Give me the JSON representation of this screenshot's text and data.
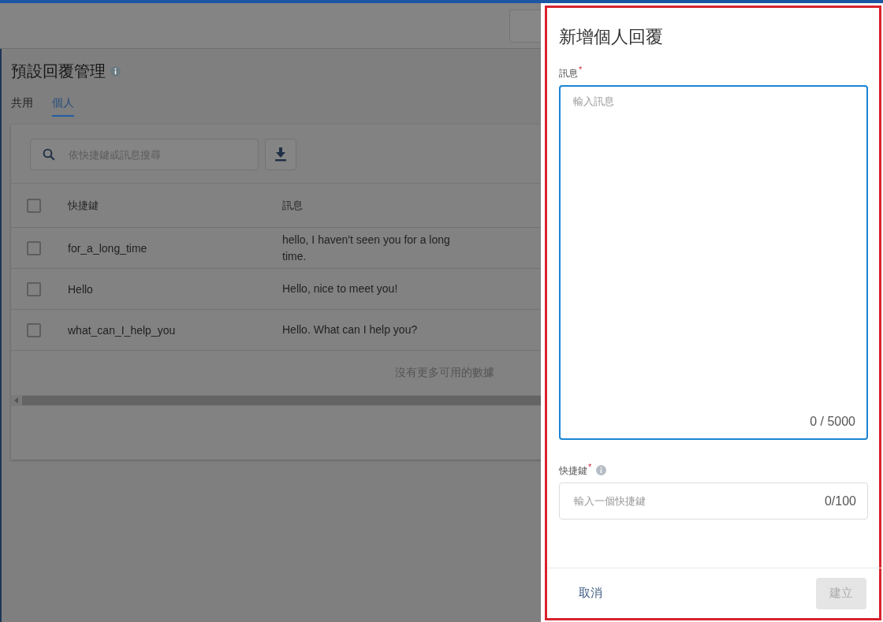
{
  "page": {
    "title": "預設回覆管理",
    "tabs": [
      {
        "label": "共用",
        "selected": false
      },
      {
        "label": "個人",
        "selected": true
      }
    ],
    "search": {
      "placeholder": "依快捷鍵或訊息搜尋"
    },
    "table": {
      "columns": [
        "快捷鍵",
        "訊息"
      ],
      "all_checked": false,
      "rows": [
        {
          "shortcut": "for_a_long_time",
          "message": "hello, I haven't seen you for a long time.",
          "checked": false
        },
        {
          "shortcut": "Hello",
          "message": "Hello, nice to meet you!",
          "checked": false
        },
        {
          "shortcut": "what_can_I_help_you",
          "message": "Hello. What can I help you?",
          "checked": false
        }
      ],
      "empty_message": "沒有更多可用的數據"
    }
  },
  "drawer": {
    "title": "新增個人回覆",
    "fields": [
      {
        "kind": "textarea",
        "label": "訊息",
        "required_mark": "*",
        "info": false,
        "placeholder": "輸入訊息",
        "counter": "0 / 5000",
        "focused": true
      },
      {
        "kind": "input",
        "label": "快捷鍵",
        "required_mark": "*",
        "info": true,
        "placeholder": "輸入一個快捷鍵",
        "counter": "0/100",
        "focused": false
      }
    ],
    "buttons": [
      {
        "kind": "cancel",
        "label": "取消",
        "disabled": false
      },
      {
        "kind": "submit",
        "label": "建立",
        "disabled": true
      }
    ]
  }
}
